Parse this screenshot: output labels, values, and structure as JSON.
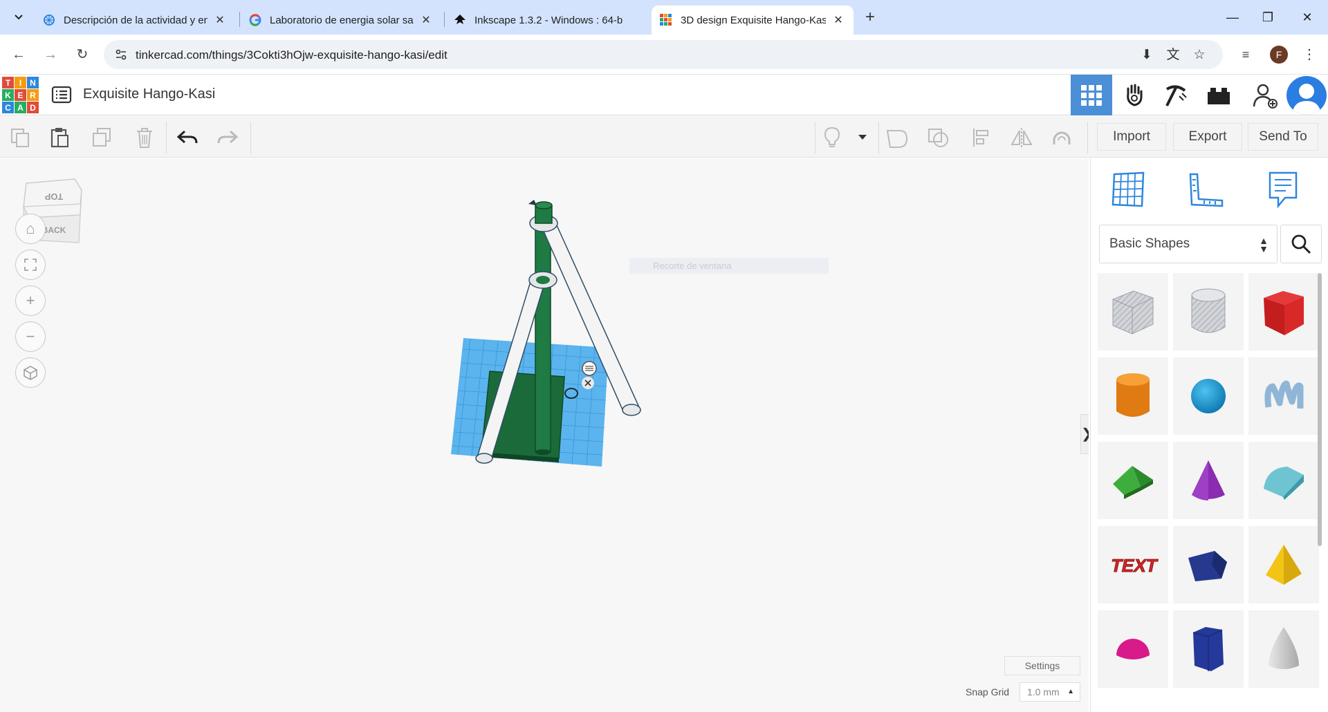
{
  "browser": {
    "tabs": [
      {
        "title": "Descripción de la actividad y en",
        "favicon": "gear-snowflake-icon"
      },
      {
        "title": "Laboratorio de energia solar sa",
        "favicon": "google-icon"
      },
      {
        "title": "Inkscape 1.3.2 - Windows : 64-b",
        "favicon": "inkscape-icon"
      },
      {
        "title": "3D design Exquisite Hango-Kas",
        "favicon": "tinkercad-icon",
        "active": true
      }
    ],
    "new_tab": "+",
    "minimize": "—",
    "restore": "❐",
    "close": "✕",
    "url": "tinkercad.com/things/3Cokti3hOjw-exquisite-hango-kasi/edit",
    "profile_initial": "F"
  },
  "app": {
    "logo_letters": [
      "T",
      "I",
      "N",
      "K",
      "E",
      "R",
      "C",
      "A",
      "D"
    ],
    "logo_colors": [
      "#e24b3a",
      "#f39c12",
      "#2e86de",
      "#27ae60",
      "#e24b3a",
      "#f39c12",
      "#2e86de",
      "#27ae60",
      "#e24b3a"
    ],
    "design_title": "Exquisite Hango-Kasi"
  },
  "toolbar": {
    "import_label": "Import",
    "export_label": "Export",
    "send_to_label": "Send To"
  },
  "workplane": {
    "viewcube_top": "TOP",
    "viewcube_back": "BACK",
    "faint_overlay": "Recorte de ventana",
    "settings_label": "Settings",
    "snap_grid_label": "Snap Grid",
    "snap_grid_value": "1.0 mm"
  },
  "panel": {
    "category": "Basic Shapes",
    "shapes": [
      "box-hole",
      "cylinder-hole",
      "box",
      "cylinder",
      "sphere",
      "scribble",
      "roof",
      "cone",
      "round-roof",
      "text",
      "wedge",
      "pyramid",
      "half-sphere",
      "polygon",
      "paraboloid"
    ]
  },
  "colors": {
    "accent": "#4b8fd6",
    "tab_strip": "#d3e3fd"
  }
}
